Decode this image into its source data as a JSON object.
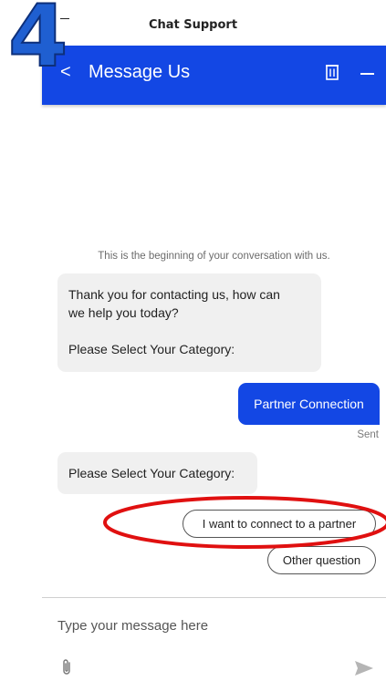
{
  "step_badge": "4",
  "top_bar": {
    "title": "Chat Support"
  },
  "header": {
    "back_glyph": "<",
    "title": "Message Us",
    "icons": [
      "back-icon",
      "trash-icon",
      "minimize-icon"
    ]
  },
  "conversation": {
    "begin_note": "This is the beginning of your conversation with us.",
    "agent_message_1": {
      "line1": "Thank you for contacting us, how can",
      "line2": "we help you today?",
      "line3": "Please Select Your Category:"
    },
    "user_message": {
      "text": "Partner Connection",
      "status": "Sent"
    },
    "agent_message_2": "Please Select Your Category:",
    "quick_replies": [
      "I want to connect to a partner",
      "Other question"
    ]
  },
  "composer": {
    "placeholder": "Type your message here",
    "icons": [
      "paperclip-icon",
      "send-icon"
    ]
  },
  "colors": {
    "header_bg": "#1347e4",
    "user_bubble_bg": "#1347e4",
    "agent_bubble_bg": "#f0f0f0",
    "annotation_red": "#e01010",
    "badge_blue": "#1f5fd1"
  }
}
